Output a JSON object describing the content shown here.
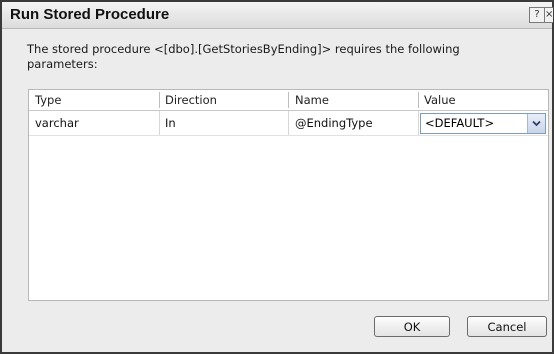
{
  "dialog": {
    "title": "Run Stored Procedure",
    "help_glyph": "?",
    "close_glyph": "×",
    "message_line1": "The stored procedure <[dbo].[GetStoriesByEnding]> requires the following",
    "message_line2": "parameters:"
  },
  "grid": {
    "columns": [
      "Type",
      "Direction",
      "Name",
      "Value"
    ],
    "rows": [
      {
        "type": "varchar",
        "direction": "In",
        "name": "@EndingType",
        "value": "<DEFAULT>"
      }
    ]
  },
  "buttons": {
    "ok": "OK",
    "cancel": "Cancel"
  }
}
